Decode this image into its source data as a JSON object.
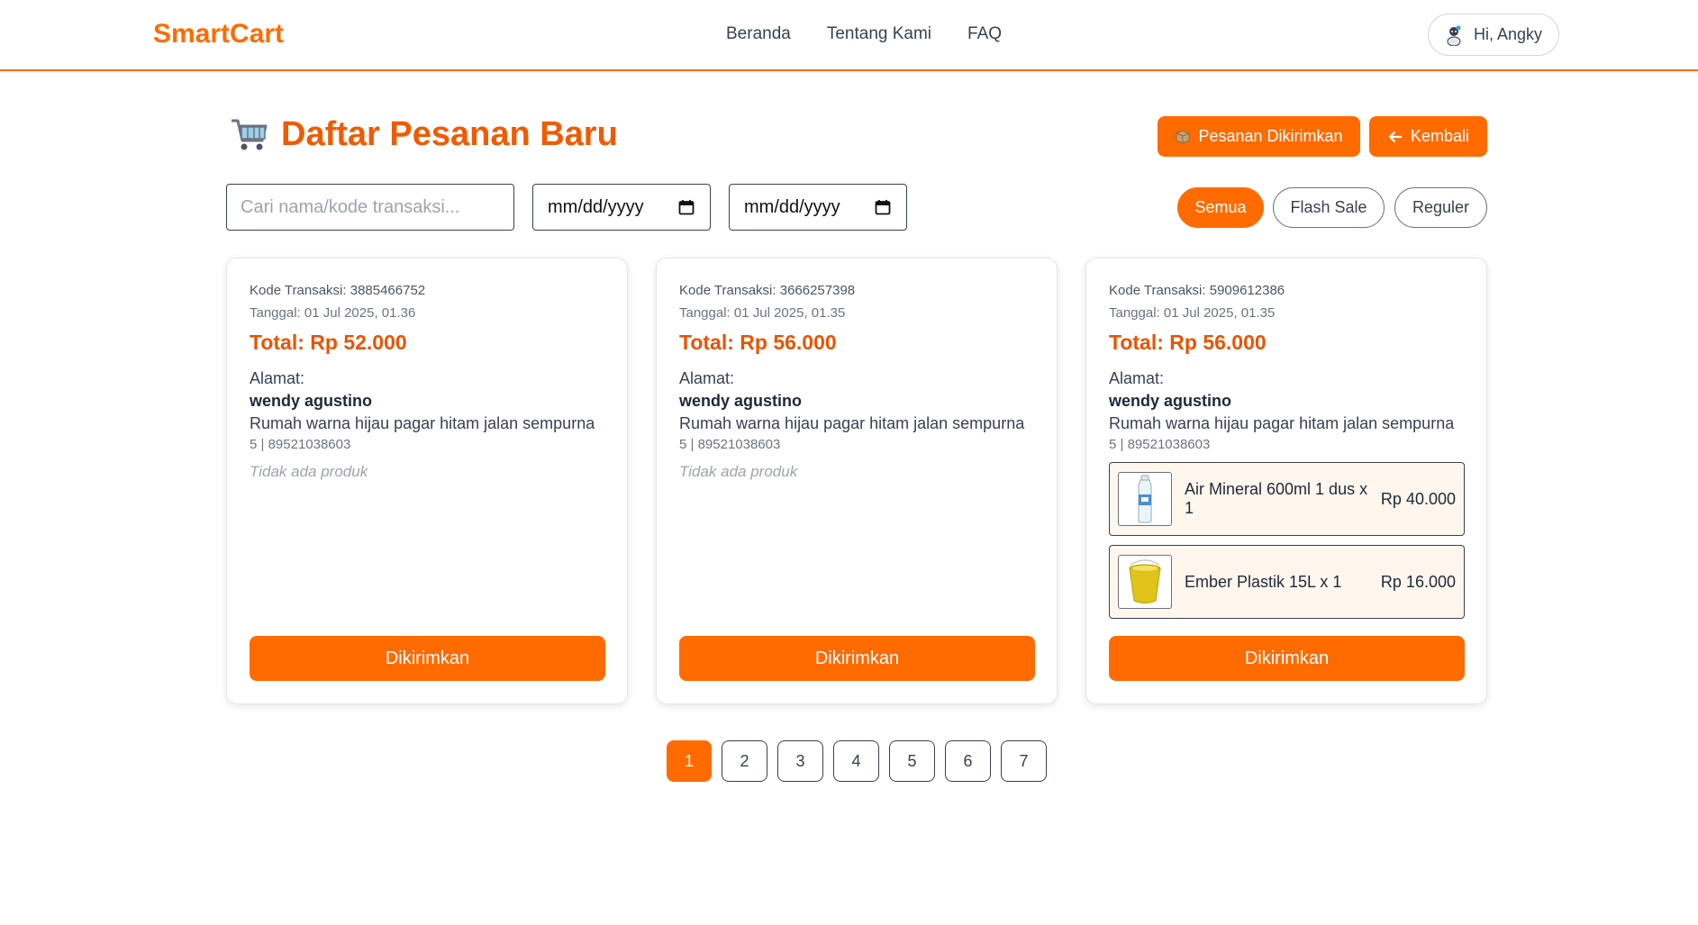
{
  "header": {
    "brand": "SmartCart",
    "nav": [
      "Beranda",
      "Tentang Kami",
      "FAQ"
    ],
    "user_greeting": "Hi, Angky"
  },
  "page": {
    "title": "Daftar Pesanan Baru",
    "shipped_button": "Pesanan Dikirimkan",
    "back_button": "Kembali"
  },
  "filters": {
    "search_placeholder": "Cari nama/kode transaksi...",
    "date_from": "mm/dd/yyyy",
    "date_to": "mm/dd/yyyy",
    "types": [
      "Semua",
      "Flash Sale",
      "Reguler"
    ],
    "active_type": "Semua"
  },
  "orders": [
    {
      "code": "Kode Transaksi: 3885466752",
      "date": "Tanggal: 01 Jul 2025, 01.36",
      "total": "Total: Rp 52.000",
      "address_label": "Alamat:",
      "name": "wendy agustino",
      "address": "Rumah warna hijau pagar hitam jalan sempurna",
      "phone": "5 | 89521038603",
      "empty_text": "Tidak ada produk",
      "action": "Dikirimkan"
    },
    {
      "code": "Kode Transaksi: 3666257398",
      "date": "Tanggal: 01 Jul 2025, 01.35",
      "total": "Total: Rp 56.000",
      "address_label": "Alamat:",
      "name": "wendy agustino",
      "address": "Rumah warna hijau pagar hitam jalan sempurna",
      "phone": "5 | 89521038603",
      "empty_text": "Tidak ada produk",
      "action": "Dikirimkan"
    },
    {
      "code": "Kode Transaksi: 5909612386",
      "date": "Tanggal: 01 Jul 2025, 01.35",
      "total": "Total: Rp 56.000",
      "address_label": "Alamat:",
      "name": "wendy agustino",
      "address": "Rumah warna hijau pagar hitam jalan sempurna",
      "phone": "5 | 89521038603",
      "products": [
        {
          "name": "Air Mineral 600ml 1 dus x 1",
          "price": "Rp 40.000",
          "icon": "water-bottle-icon"
        },
        {
          "name": "Ember Plastik 15L x 1",
          "price": "Rp 16.000",
          "icon": "bucket-icon"
        }
      ],
      "action": "Dikirimkan"
    }
  ],
  "pagination": {
    "pages": [
      "1",
      "2",
      "3",
      "4",
      "5",
      "6",
      "7"
    ],
    "current": "1"
  },
  "colors": {
    "accent": "#ff6b00",
    "title": "#f05a00",
    "total": "#e85400"
  }
}
